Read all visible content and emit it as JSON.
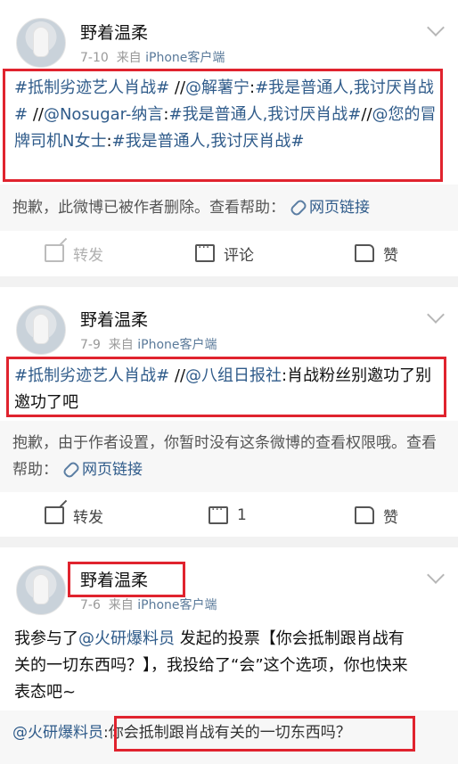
{
  "posts": [
    {
      "user": "野着温柔",
      "date": "7-10",
      "source_prefix": "来自",
      "source": "iPhone客户端",
      "body": [
        {
          "t": "#抵制劣迹艺人肖战#",
          "c": "blue"
        },
        {
          "t": " //",
          "c": ""
        },
        {
          "t": "@解薯宁",
          "c": "blue"
        },
        {
          "t": ":",
          "c": ""
        },
        {
          "t": "#我是普通人,我讨厌肖战#",
          "c": "blue"
        },
        {
          "t": " //",
          "c": ""
        },
        {
          "t": "@Nosugar-纳言",
          "c": "blue"
        },
        {
          "t": ":",
          "c": ""
        },
        {
          "t": "#我是普通人,我讨厌肖战#",
          "c": "blue"
        },
        {
          "t": "//",
          "c": ""
        },
        {
          "t": "@您的冒牌司机N女士",
          "c": "blue"
        },
        {
          "t": ":",
          "c": ""
        },
        {
          "t": "#我是普通人,我讨厌肖战#",
          "c": "blue"
        }
      ],
      "notice": "抱歉，此微博已被作者删除。查看帮助：",
      "link": "网页链接",
      "actions": {
        "forward": "转发",
        "comment": "评论",
        "like": "赞"
      }
    },
    {
      "user": "野着温柔",
      "date": "7-9",
      "source_prefix": "来自",
      "source": "iPhone客户端",
      "body": [
        {
          "t": "#抵制劣迹艺人肖战#",
          "c": "blue"
        },
        {
          "t": " //",
          "c": ""
        },
        {
          "t": "@八组日报社",
          "c": "blue"
        },
        {
          "t": ":肖战粉丝别邀功了别邀功了吧",
          "c": ""
        }
      ],
      "notice": "抱歉，由于作者设置，你暂时没有这条微博的查看权限哦。查看帮助：",
      "link": "网页链接",
      "actions": {
        "forward": "转发",
        "comment": "1",
        "like": "赞"
      }
    },
    {
      "user": "野着温柔",
      "date": "7-6",
      "source_prefix": "来自",
      "source": "iPhone客户端",
      "body": [
        {
          "t": "我参与了",
          "c": ""
        },
        {
          "t": "@火研爆料员",
          "c": "blue"
        },
        {
          "t": " 发起的投票【你会抵制跟肖战有关的一切东西吗？】，我投给了“会”这个选项，你也快来表态吧~",
          "c": ""
        }
      ],
      "quote_user": "@火研爆料员",
      "quote_text": ":你会抵制跟肖战有关的一切东西吗？"
    }
  ]
}
